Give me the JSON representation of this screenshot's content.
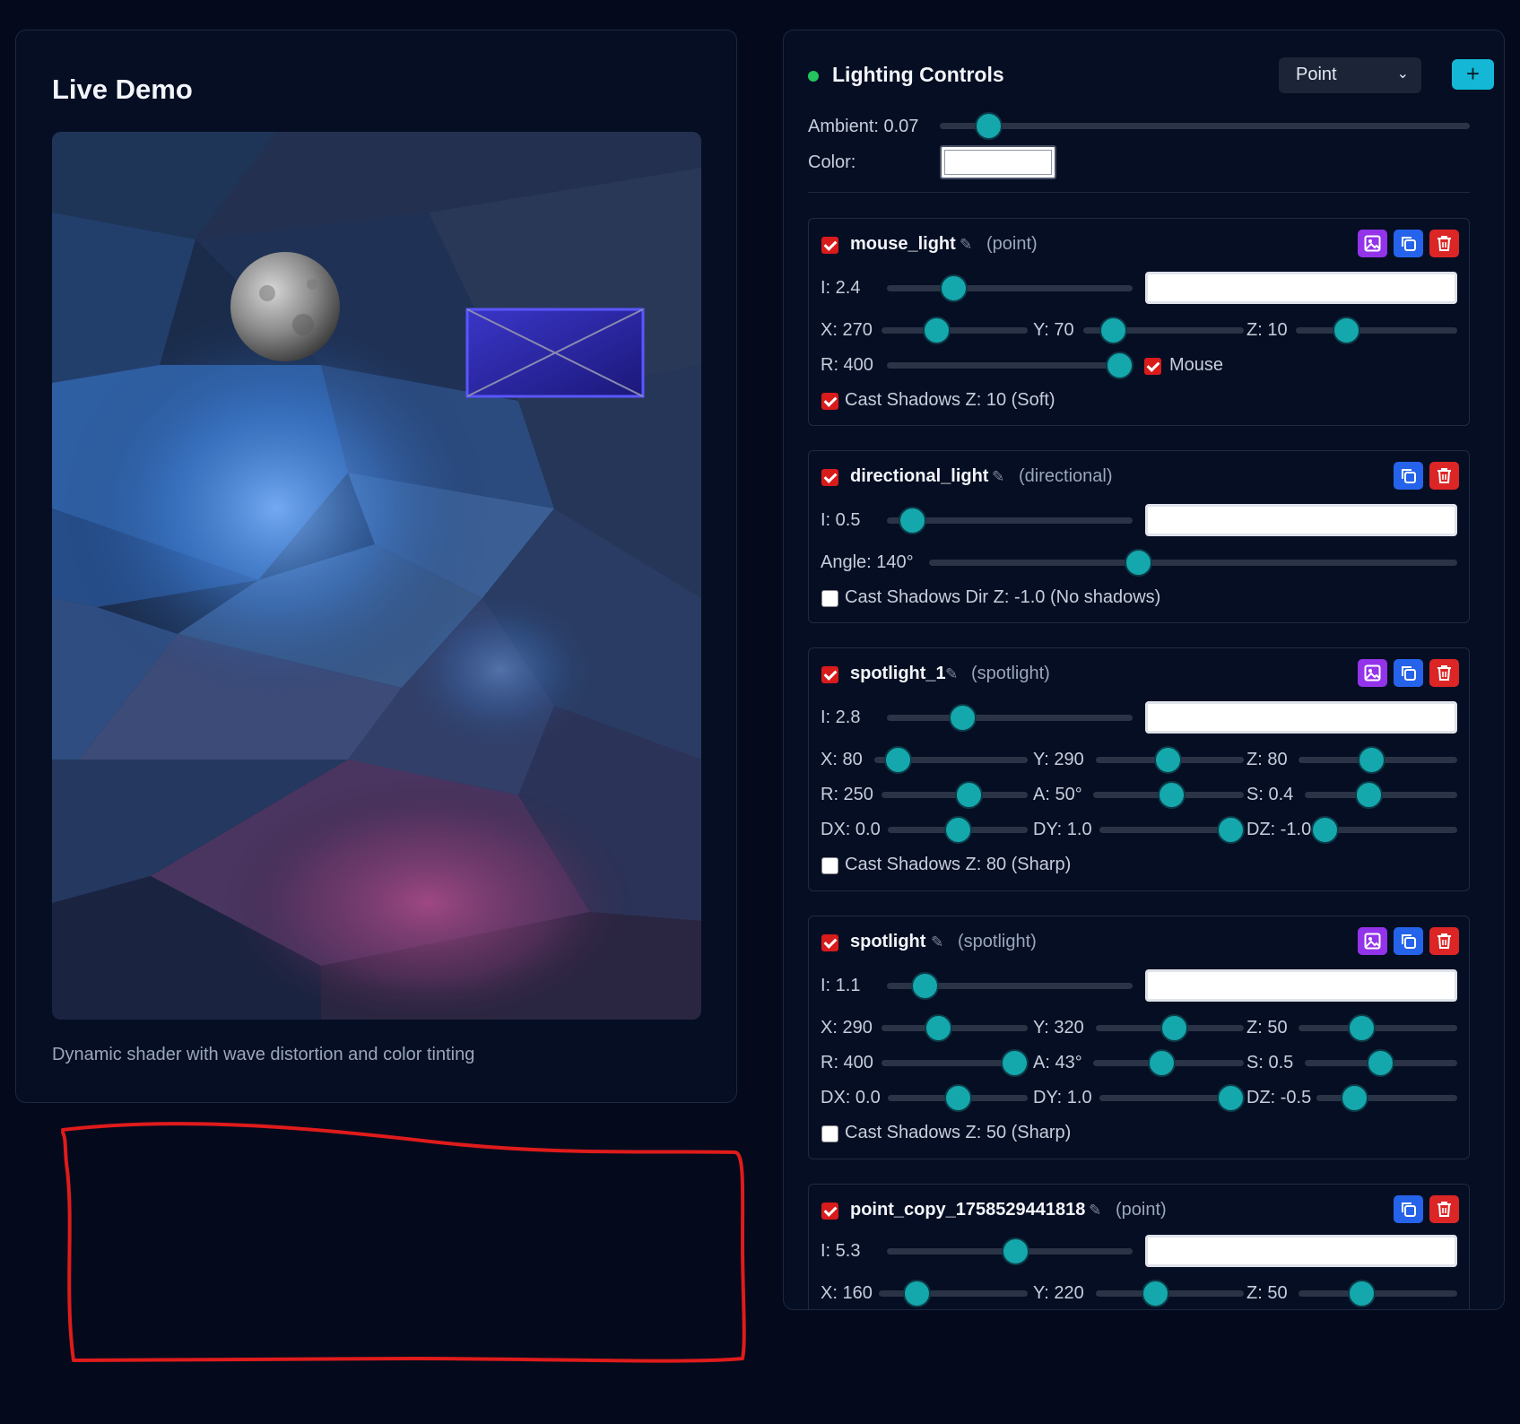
{
  "demo": {
    "title": "Live Demo",
    "caption": "Dynamic shader with wave distortion and color tinting"
  },
  "controls": {
    "title": "Lighting Controls",
    "type_select": "Point",
    "add_label": "+",
    "ambient_label": "Ambient: 0.07",
    "ambient_value": 0.07,
    "color_label": "Color:",
    "lights": [
      {
        "name": "mouse_light",
        "type": "(point)",
        "enabled": true,
        "buttons": [
          "image-icon",
          "copy-icon",
          "trash-icon"
        ],
        "intensity_label": "I: 2.4",
        "x_label": "X: 270",
        "y_label": "Y: 70",
        "z_label": "Z: 10",
        "r_label": "R: 400",
        "mouse_label": "Mouse",
        "mouse_checked": true,
        "shadow_label": "Cast Shadows Z: 10 (Soft)",
        "shadow_checked": true
      },
      {
        "name": "directional_light",
        "type": "(directional)",
        "enabled": true,
        "buttons": [
          "copy-icon",
          "trash-icon"
        ],
        "intensity_label": "I: 0.5",
        "angle_label": "Angle: 140°",
        "shadow_label": "Cast Shadows Dir Z: -1.0 (No shadows)",
        "shadow_checked": false
      },
      {
        "name": "spotlight_1",
        "type": "(spotlight)",
        "enabled": true,
        "buttons": [
          "image-icon",
          "copy-icon",
          "trash-icon"
        ],
        "intensity_label": "I: 2.8",
        "x_label": "X: 80",
        "y_label": "Y: 290",
        "z_label": "Z: 80",
        "r_label": "R: 250",
        "a_label": "A: 50°",
        "s_label": "S: 0.4",
        "dx_label": "DX: 0.0",
        "dy_label": "DY: 1.0",
        "dz_label": "DZ: -1.0",
        "shadow_label": "Cast Shadows Z: 80 (Sharp)",
        "shadow_checked": false
      },
      {
        "name": "spotlight",
        "type": "(spotlight)",
        "enabled": true,
        "buttons": [
          "image-icon",
          "copy-icon",
          "trash-icon"
        ],
        "intensity_label": "I: 1.1",
        "x_label": "X: 290",
        "y_label": "Y: 320",
        "z_label": "Z: 50",
        "r_label": "R: 400",
        "a_label": "A: 43°",
        "s_label": "S: 0.5",
        "dx_label": "DX: 0.0",
        "dy_label": "DY: 1.0",
        "dz_label": "DZ: -0.5",
        "shadow_label": "Cast Shadows Z: 50 (Sharp)",
        "shadow_checked": false
      },
      {
        "name": "point_copy_1758529441818",
        "type": "(point)",
        "enabled": true,
        "buttons": [
          "copy-icon",
          "trash-icon"
        ],
        "intensity_label": "I: 5.3",
        "x_label": "X: 160",
        "y_label": "Y: 220",
        "z_label": "Z: 50"
      }
    ]
  },
  "colors": {
    "background": "#040a1c",
    "panel": "#050e23",
    "accent": "#14b8d6",
    "slider_thumb": "#14a8ad",
    "checkbox": "#d81b1b",
    "status": "#22c55e",
    "annotation": "#e01b1b"
  }
}
